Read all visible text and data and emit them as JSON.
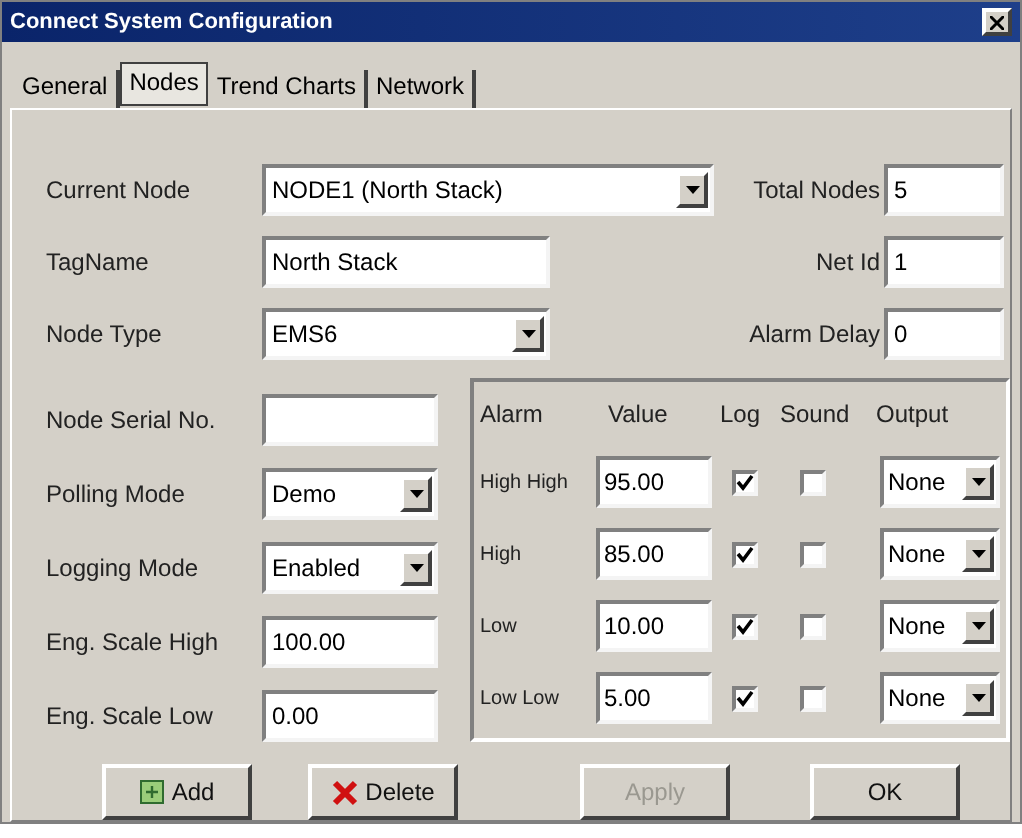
{
  "window": {
    "title": "Connect System Configuration"
  },
  "tabs": [
    {
      "label": "General",
      "selected": false
    },
    {
      "label": "Nodes",
      "selected": true
    },
    {
      "label": "Trend Charts",
      "selected": false
    },
    {
      "label": "Network",
      "selected": false
    }
  ],
  "top_rows": [
    {
      "left": {
        "label": "Current Node",
        "value": "NODE1 (North Stack)",
        "kind": "dropdown"
      },
      "right": {
        "label": "Total Nodes",
        "value": "5"
      }
    },
    {
      "left": {
        "label": "TagName",
        "value": "North Stack",
        "kind": "text"
      },
      "right": {
        "label": "Net Id",
        "value": "1"
      }
    },
    {
      "left": {
        "label": "Node Type",
        "value": "EMS6",
        "kind": "dropdown"
      },
      "right": {
        "label": "Alarm Delay",
        "value": "0"
      }
    }
  ],
  "left_fields": [
    {
      "label": "Node Serial No.",
      "kind": "text"
    },
    {
      "label": "Polling Mode",
      "value": "Demo",
      "kind": "dropdown"
    },
    {
      "label": "Logging Mode",
      "value": "Enabled",
      "kind": "dropdown"
    },
    {
      "label": "Eng. Scale High",
      "value": "100.00",
      "kind": "text"
    },
    {
      "label": "Eng. Scale Low",
      "value": "0.00",
      "kind": "text"
    }
  ],
  "alarm_table": {
    "columns": [
      "Alarm",
      "Value",
      "Log",
      "Sound",
      "Output"
    ],
    "rows": [
      {
        "alarm": "High High",
        "value": "95.00",
        "log": true,
        "sound": false,
        "output": "None"
      },
      {
        "alarm": "High",
        "value": "85.00",
        "log": true,
        "sound": false,
        "output": "None"
      },
      {
        "alarm": "Low",
        "value": "10.00",
        "log": true,
        "sound": false,
        "output": "None"
      },
      {
        "alarm": "Low Low",
        "value": "5.00",
        "log": true,
        "sound": false,
        "output": "None"
      }
    ]
  },
  "buttons": [
    {
      "label": "Add",
      "kind": "add",
      "disabled": false
    },
    {
      "label": "Delete",
      "kind": "delete",
      "disabled": false
    },
    {
      "label": "Apply",
      "kind": "plain",
      "disabled": true
    },
    {
      "label": "OK",
      "kind": "plain",
      "disabled": false
    }
  ]
}
